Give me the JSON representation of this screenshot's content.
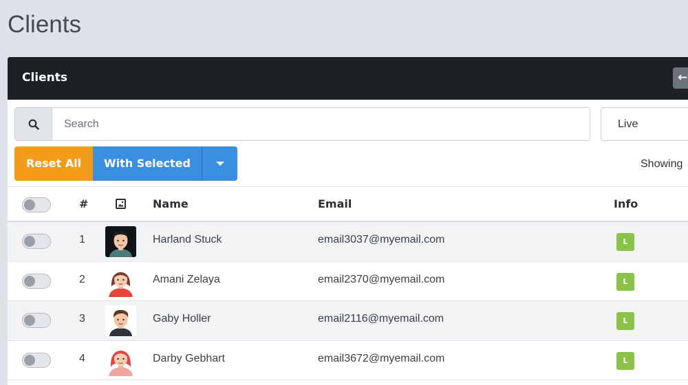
{
  "page": {
    "title": "Clients"
  },
  "card": {
    "title": "Clients",
    "back_icon": "←"
  },
  "search": {
    "placeholder": "Search",
    "value": ""
  },
  "status_filter": {
    "selected": "Live"
  },
  "toolbar": {
    "reset_label": "Reset All",
    "with_selected_label": "With Selected",
    "showing_text": "Showing"
  },
  "table": {
    "headers": {
      "number": "#",
      "name": "Name",
      "email": "Email",
      "info": "Info"
    },
    "rows": [
      {
        "number": "1",
        "name": "Harland Stuck",
        "email": "email3037@myemail.com",
        "info": "L"
      },
      {
        "number": "2",
        "name": "Amani Zelaya",
        "email": "email2370@myemail.com",
        "info": "L"
      },
      {
        "number": "3",
        "name": "Gaby Holler",
        "email": "email2116@myemail.com",
        "info": "L"
      },
      {
        "number": "4",
        "name": "Darby Gebhart",
        "email": "email3672@myemail.com",
        "info": "L"
      }
    ]
  },
  "colors": {
    "header_bg": "#1c2126",
    "reset_button": "#f39c1a",
    "primary_button": "#3a8fe1",
    "info_badge": "#8bc34a"
  }
}
